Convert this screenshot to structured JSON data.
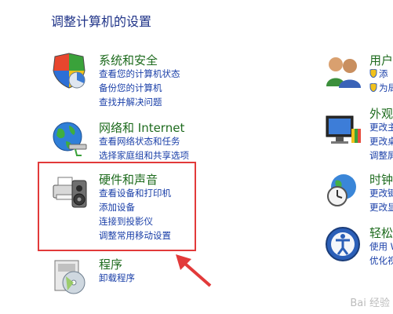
{
  "page": {
    "title": "调整计算机的设置"
  },
  "categories": {
    "system": {
      "title": "系统和安全",
      "links": [
        "查看您的计算机状态",
        "备份您的计算机",
        "查找并解决问题"
      ]
    },
    "network": {
      "title": "网络和 Internet",
      "links": [
        "查看网络状态和任务",
        "选择家庭组和共享选项"
      ]
    },
    "hardware": {
      "title": "硬件和声音",
      "links": [
        "查看设备和打印机",
        "添加设备",
        "连接到投影仪",
        "调整常用移动设置"
      ]
    },
    "programs": {
      "title": "程序",
      "links": [
        "卸载程序"
      ]
    },
    "users": {
      "title": "用户",
      "links": [
        "添",
        "为局"
      ]
    },
    "appearance": {
      "title": "外观",
      "links": [
        "更改主",
        "更改桌",
        "调整屏"
      ]
    },
    "clock": {
      "title": "时钟",
      "links": [
        "更改键",
        "更改显"
      ]
    },
    "ease": {
      "title": "轻松",
      "links": [
        "使用 W",
        "优化视"
      ]
    }
  },
  "watermark": "Bai 经验",
  "colors": {
    "highlight": "#e23a3a",
    "link": "#1a3fa8",
    "category": "#1e6b1e"
  }
}
